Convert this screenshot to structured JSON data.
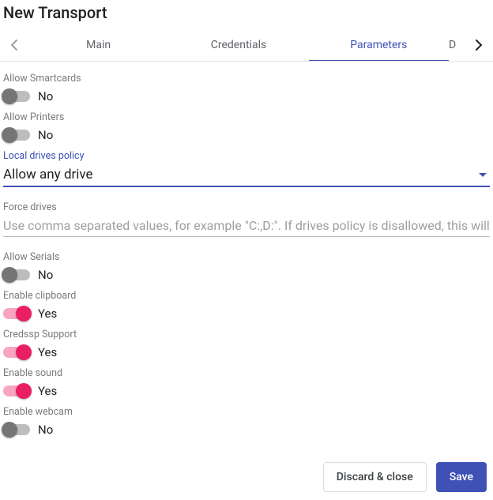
{
  "title": "New Transport",
  "tabs": {
    "main": "Main",
    "credentials": "Credentials",
    "parameters": "Parameters",
    "partial": "D"
  },
  "fields": {
    "smartcards": {
      "label": "Allow Smartcards",
      "value": "No"
    },
    "printers": {
      "label": "Allow Printers",
      "value": "No"
    },
    "drives_policy": {
      "label": "Local drives policy",
      "value": "Allow any drive"
    },
    "force_drives": {
      "label": "Force drives",
      "placeholder": "Use comma separated values, for example \"C:,D:\". If drives policy is disallowed, this will"
    },
    "serials": {
      "label": "Allow Serials",
      "value": "No"
    },
    "clipboard": {
      "label": "Enable clipboard",
      "value": "Yes"
    },
    "credssp": {
      "label": "Credssp Support",
      "value": "Yes"
    },
    "sound": {
      "label": "Enable sound",
      "value": "Yes"
    },
    "webcam": {
      "label": "Enable webcam",
      "value": "No"
    }
  },
  "actions": {
    "discard": "Discard & close",
    "save": "Save"
  }
}
